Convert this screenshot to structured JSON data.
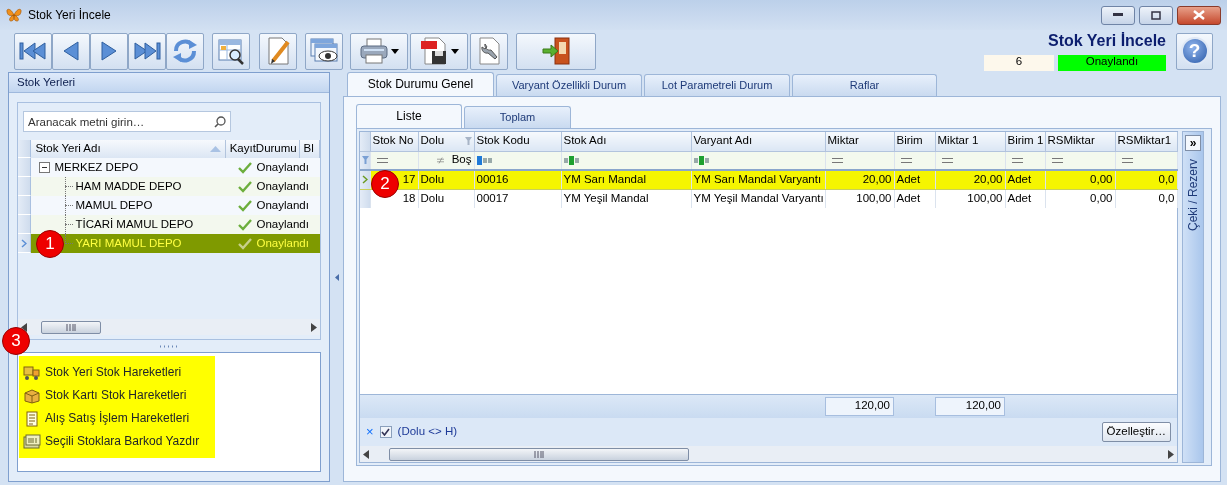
{
  "window": {
    "title": "Stok Yeri İncele"
  },
  "toolbar": {
    "buttons": [
      {
        "kind": "first",
        "dropdown": false
      },
      {
        "kind": "prev",
        "dropdown": false
      },
      {
        "kind": "next",
        "dropdown": false
      },
      {
        "kind": "last",
        "dropdown": false
      },
      {
        "kind": "refresh",
        "dropdown": false
      },
      {
        "kind": "grid_search",
        "dropdown": false
      },
      {
        "kind": "edit",
        "dropdown": false
      },
      {
        "kind": "view",
        "dropdown": false
      },
      {
        "kind": "print",
        "dropdown": true
      },
      {
        "kind": "pdf",
        "dropdown": true
      },
      {
        "kind": "tools",
        "dropdown": false
      },
      {
        "kind": "exit",
        "dropdown": false
      }
    ]
  },
  "header": {
    "title": "Stok Yeri İncele",
    "record_no": "6",
    "status": "Onaylandı",
    "help_glyph": "?"
  },
  "left_panel": {
    "title": "Stok Yerleri",
    "search": {
      "placeholder": "Aranacak metni girin…"
    },
    "tree": {
      "columns": [
        {
          "label": "Stok Yeri Adı",
          "sorted": true
        },
        {
          "label": "KayıtDurumu"
        },
        {
          "label": "Bl"
        }
      ],
      "rows": [
        {
          "name": "MERKEZ DEPO",
          "status": "Onaylandı",
          "selected": false,
          "expanded": true,
          "children": [
            {
              "name": "HAM MADDE DEPO",
              "status": "Onaylandı",
              "selected": false
            },
            {
              "name": "MAMUL DEPO",
              "status": "Onaylandı",
              "selected": false
            },
            {
              "name": "TİCARİ MAMUL DEPO",
              "status": "Onaylandı",
              "selected": false
            },
            {
              "name": "YARI MAMUL DEPO",
              "status": "Onaylandı",
              "selected": true
            }
          ]
        }
      ]
    },
    "actions": [
      {
        "kind": "truck",
        "label": "Stok Yeri Stok Hareketleri"
      },
      {
        "kind": "box",
        "label": "Stok Kartı Stok Hareketleri"
      },
      {
        "kind": "document",
        "label": "Alış Satış İşlem Hareketleri"
      },
      {
        "kind": "window",
        "label": "Seçili Stoklara Barkod Yazdır"
      }
    ]
  },
  "tabs": [
    {
      "label": "Stok Durumu Genel",
      "selected": true
    },
    {
      "label": "Varyant Özellikli Durum",
      "selected": false
    },
    {
      "label": "Lot Parametreli Durum",
      "selected": false
    },
    {
      "label": "Raflar",
      "selected": false
    }
  ],
  "subtabs": [
    {
      "label": "Liste",
      "selected": true
    },
    {
      "label": "Toplam",
      "selected": false
    }
  ],
  "grid": {
    "columns": [
      {
        "label": "Stok No",
        "filter": {
          "kind": "equals"
        }
      },
      {
        "label": "Dolu",
        "header_filter": true,
        "filter": {
          "kind": "not_equals",
          "value": "Boş"
        }
      },
      {
        "label": "Stok Kodu",
        "filter": {
          "kind": "starts_with"
        }
      },
      {
        "label": "Stok Adı",
        "filter": {
          "kind": "contains"
        }
      },
      {
        "label": "Varyant Adı",
        "filter": {
          "kind": "contains"
        }
      },
      {
        "label": "Miktar",
        "filter": {
          "kind": "equals"
        },
        "total": "120,00"
      },
      {
        "label": "Birim",
        "filter": {
          "kind": "equals"
        }
      },
      {
        "label": "Miktar 1",
        "filter": {
          "kind": "equals"
        },
        "total": "120,00"
      },
      {
        "label": "Birim 1",
        "filter": {
          "kind": "equals"
        }
      },
      {
        "label": "RSMiktar",
        "filter": {
          "kind": "equals"
        }
      },
      {
        "label": "RSMiktar1",
        "filter": {
          "kind": "equals"
        }
      }
    ],
    "rows": [
      {
        "selected": true,
        "cells": [
          "17",
          "Dolu",
          "00016",
          "YM Sarı Mandal",
          "YM Sarı Mandal Varyantı",
          "20,00",
          "Adet",
          "20,00",
          "Adet",
          "0,00",
          "0,0"
        ]
      },
      {
        "selected": false,
        "cells": [
          "18",
          "Dolu",
          "00017",
          "YM Yeşil Mandal",
          "YM Yeşil Mandal Varyantı",
          "100,00",
          "Adet",
          "100,00",
          "Adet",
          "0,00",
          "0,0"
        ]
      }
    ],
    "filter_bar": {
      "clear_glyph": "×",
      "checked": true,
      "text": "(Dolu <> H)"
    },
    "customize_button": "Özelleştir…"
  },
  "side_panel": {
    "toggle_glyph": "»",
    "label": "Çeki / Rezerv"
  },
  "callouts": [
    "1",
    "2",
    "3"
  ]
}
